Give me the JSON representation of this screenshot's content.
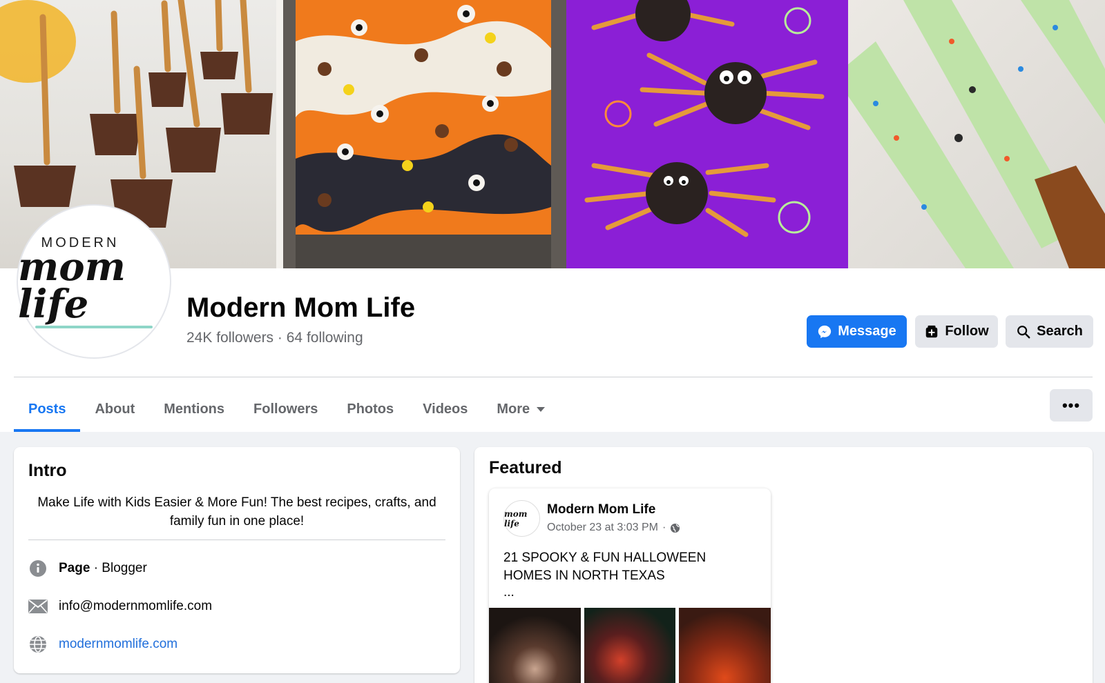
{
  "cover": {
    "tiles": [
      "pretzel-broomstick-treats",
      "halloween-bark",
      "oreo-spiders",
      "witch-finger-pretzels"
    ]
  },
  "profile": {
    "logo_top": "MODERN",
    "logo_script": "mom life",
    "name": "Modern Mom Life",
    "followers": "24K followers",
    "separator": "·",
    "following": "64 following"
  },
  "actions": {
    "message_label": "Message",
    "follow_label": "Follow",
    "search_label": "Search",
    "accent": "#1877f2"
  },
  "tabs": [
    {
      "label": "Posts",
      "active": true
    },
    {
      "label": "About"
    },
    {
      "label": "Mentions"
    },
    {
      "label": "Followers"
    },
    {
      "label": "Photos"
    },
    {
      "label": "Videos"
    },
    {
      "label": "More"
    }
  ],
  "more_dots": "•••",
  "intro": {
    "title": "Intro",
    "bio": "Make Life with Kids Easier & More Fun! The best recipes, crafts, and family fun in one place!",
    "page_label": "Page",
    "page_category": " · Blogger",
    "email": "info@modernmomlife.com",
    "website": "modernmomlife.com"
  },
  "featured": {
    "title": "Featured",
    "post": {
      "author": "Modern Mom Life",
      "timestamp": "October 23 at 3:03 PM",
      "meta_separator": "·",
      "text": "21 SPOOKY & FUN HALLOWEEN HOMES IN NORTH TEXAS",
      "ellipsis": "..."
    }
  }
}
